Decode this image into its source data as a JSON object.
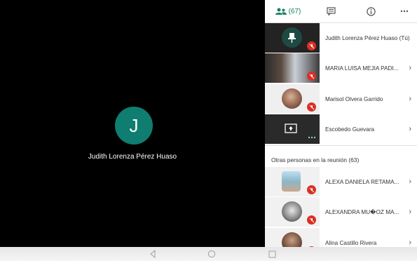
{
  "presenter": {
    "initial": "J",
    "name": "Judith Lorenza Pérez Huaso"
  },
  "tabs": {
    "people_count": "(67)"
  },
  "participants": [
    {
      "name": "Judith Lorenza Pérez Huaso (Tú)"
    },
    {
      "name": "MARIA LUISA MEJIA PADI..."
    },
    {
      "name": "Marisol Olvera Garrido"
    },
    {
      "name": "Escobedo Guevara"
    }
  ],
  "others": {
    "title": "Otras personas en la reunión (63)",
    "items": [
      {
        "name": "ALEXA DANIELA RETAMA..."
      },
      {
        "name": "ALEXANDRA MU�OZ MA..."
      },
      {
        "name": "Alina Castillo Rivera"
      }
    ]
  },
  "icons": {
    "people": "people-icon",
    "chat": "chat-icon",
    "info": "info-icon",
    "more": "more-icon",
    "pin": "pin-icon",
    "mic_off": "mic-off-icon",
    "present": "present-screen-icon",
    "chevron": "chevron-right-icon"
  },
  "colors": {
    "accent": "#1a7f64",
    "avatar": "#0f7d6f",
    "mic_off": "#d93025"
  }
}
